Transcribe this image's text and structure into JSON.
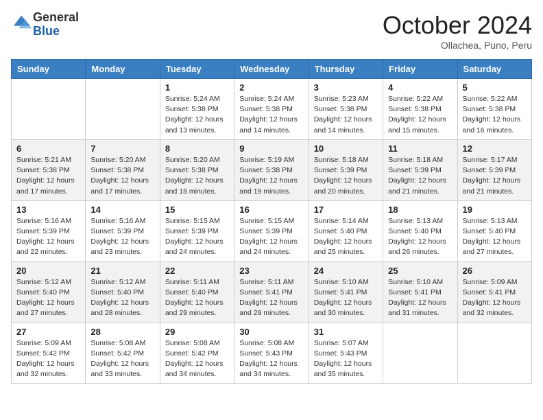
{
  "header": {
    "logo_general": "General",
    "logo_blue": "Blue",
    "month_title": "October 2024",
    "location": "Ollachea, Puno, Peru"
  },
  "days_of_week": [
    "Sunday",
    "Monday",
    "Tuesday",
    "Wednesday",
    "Thursday",
    "Friday",
    "Saturday"
  ],
  "weeks": [
    [
      {
        "day": "",
        "info": ""
      },
      {
        "day": "",
        "info": ""
      },
      {
        "day": "1",
        "info": "Sunrise: 5:24 AM\nSunset: 5:38 PM\nDaylight: 12 hours and 13 minutes."
      },
      {
        "day": "2",
        "info": "Sunrise: 5:24 AM\nSunset: 5:38 PM\nDaylight: 12 hours and 14 minutes."
      },
      {
        "day": "3",
        "info": "Sunrise: 5:23 AM\nSunset: 5:38 PM\nDaylight: 12 hours and 14 minutes."
      },
      {
        "day": "4",
        "info": "Sunrise: 5:22 AM\nSunset: 5:38 PM\nDaylight: 12 hours and 15 minutes."
      },
      {
        "day": "5",
        "info": "Sunrise: 5:22 AM\nSunset: 5:38 PM\nDaylight: 12 hours and 16 minutes."
      }
    ],
    [
      {
        "day": "6",
        "info": "Sunrise: 5:21 AM\nSunset: 5:38 PM\nDaylight: 12 hours and 17 minutes."
      },
      {
        "day": "7",
        "info": "Sunrise: 5:20 AM\nSunset: 5:38 PM\nDaylight: 12 hours and 17 minutes."
      },
      {
        "day": "8",
        "info": "Sunrise: 5:20 AM\nSunset: 5:38 PM\nDaylight: 12 hours and 18 minutes."
      },
      {
        "day": "9",
        "info": "Sunrise: 5:19 AM\nSunset: 5:38 PM\nDaylight: 12 hours and 19 minutes."
      },
      {
        "day": "10",
        "info": "Sunrise: 5:18 AM\nSunset: 5:39 PM\nDaylight: 12 hours and 20 minutes."
      },
      {
        "day": "11",
        "info": "Sunrise: 5:18 AM\nSunset: 5:39 PM\nDaylight: 12 hours and 21 minutes."
      },
      {
        "day": "12",
        "info": "Sunrise: 5:17 AM\nSunset: 5:39 PM\nDaylight: 12 hours and 21 minutes."
      }
    ],
    [
      {
        "day": "13",
        "info": "Sunrise: 5:16 AM\nSunset: 5:39 PM\nDaylight: 12 hours and 22 minutes."
      },
      {
        "day": "14",
        "info": "Sunrise: 5:16 AM\nSunset: 5:39 PM\nDaylight: 12 hours and 23 minutes."
      },
      {
        "day": "15",
        "info": "Sunrise: 5:15 AM\nSunset: 5:39 PM\nDaylight: 12 hours and 24 minutes."
      },
      {
        "day": "16",
        "info": "Sunrise: 5:15 AM\nSunset: 5:39 PM\nDaylight: 12 hours and 24 minutes."
      },
      {
        "day": "17",
        "info": "Sunrise: 5:14 AM\nSunset: 5:40 PM\nDaylight: 12 hours and 25 minutes."
      },
      {
        "day": "18",
        "info": "Sunrise: 5:13 AM\nSunset: 5:40 PM\nDaylight: 12 hours and 26 minutes."
      },
      {
        "day": "19",
        "info": "Sunrise: 5:13 AM\nSunset: 5:40 PM\nDaylight: 12 hours and 27 minutes."
      }
    ],
    [
      {
        "day": "20",
        "info": "Sunrise: 5:12 AM\nSunset: 5:40 PM\nDaylight: 12 hours and 27 minutes."
      },
      {
        "day": "21",
        "info": "Sunrise: 5:12 AM\nSunset: 5:40 PM\nDaylight: 12 hours and 28 minutes."
      },
      {
        "day": "22",
        "info": "Sunrise: 5:11 AM\nSunset: 5:40 PM\nDaylight: 12 hours and 29 minutes."
      },
      {
        "day": "23",
        "info": "Sunrise: 5:11 AM\nSunset: 5:41 PM\nDaylight: 12 hours and 29 minutes."
      },
      {
        "day": "24",
        "info": "Sunrise: 5:10 AM\nSunset: 5:41 PM\nDaylight: 12 hours and 30 minutes."
      },
      {
        "day": "25",
        "info": "Sunrise: 5:10 AM\nSunset: 5:41 PM\nDaylight: 12 hours and 31 minutes."
      },
      {
        "day": "26",
        "info": "Sunrise: 5:09 AM\nSunset: 5:41 PM\nDaylight: 12 hours and 32 minutes."
      }
    ],
    [
      {
        "day": "27",
        "info": "Sunrise: 5:09 AM\nSunset: 5:42 PM\nDaylight: 12 hours and 32 minutes."
      },
      {
        "day": "28",
        "info": "Sunrise: 5:08 AM\nSunset: 5:42 PM\nDaylight: 12 hours and 33 minutes."
      },
      {
        "day": "29",
        "info": "Sunrise: 5:08 AM\nSunset: 5:42 PM\nDaylight: 12 hours and 34 minutes."
      },
      {
        "day": "30",
        "info": "Sunrise: 5:08 AM\nSunset: 5:43 PM\nDaylight: 12 hours and 34 minutes."
      },
      {
        "day": "31",
        "info": "Sunrise: 5:07 AM\nSunset: 5:43 PM\nDaylight: 12 hours and 35 minutes."
      },
      {
        "day": "",
        "info": ""
      },
      {
        "day": "",
        "info": ""
      }
    ]
  ]
}
